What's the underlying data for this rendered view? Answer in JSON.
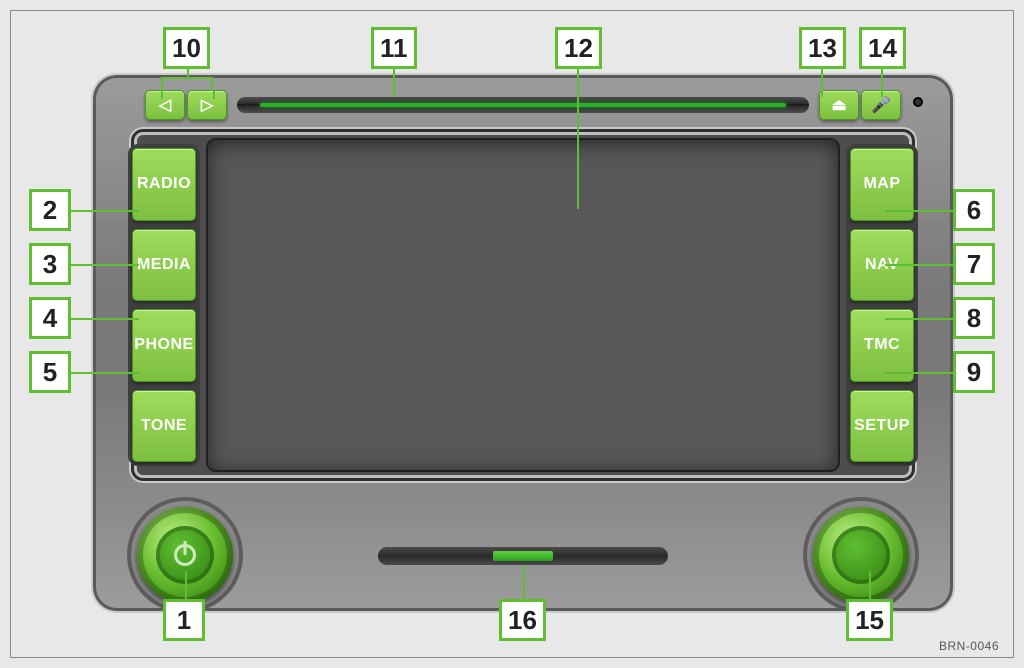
{
  "buttons_left": {
    "radio": "RADIO",
    "media": "MEDIA",
    "phone": "PHONE",
    "tone": "TONE"
  },
  "buttons_right": {
    "map": "MAP",
    "nav": "NAV",
    "tmc": "TMC",
    "setup": "SETUP"
  },
  "top": {
    "prev_glyph": "◁",
    "next_glyph": "▷",
    "eject_glyph": "⏏",
    "voice_glyph": "🎤"
  },
  "callouts": {
    "c1": "1",
    "c2": "2",
    "c3": "3",
    "c4": "4",
    "c5": "5",
    "c6": "6",
    "c7": "7",
    "c8": "8",
    "c9": "9",
    "c10": "10",
    "c11": "11",
    "c12": "12",
    "c13": "13",
    "c14": "14",
    "c15": "15",
    "c16": "16"
  },
  "image_code": "BRN-0046"
}
